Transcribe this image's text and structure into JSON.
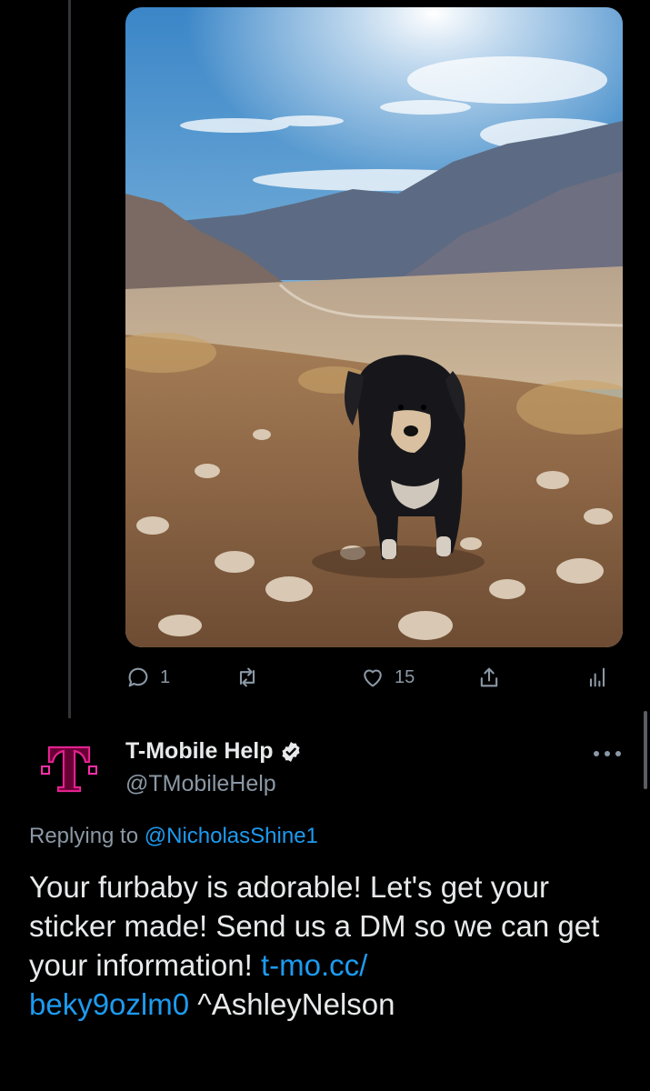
{
  "tweet": {
    "actions": {
      "reply_count": "1",
      "retweet_count": "",
      "like_count": "15"
    }
  },
  "reply": {
    "display_name": "T-Mobile Help",
    "handle": "@TMobileHelp",
    "replying_prefix": "Replying to ",
    "replying_to": "@NicholasShine1",
    "text_part1": "Your furbaby is adorable! Let's get your sticker made! Send us a DM so we can get your information! ",
    "link_line1": "t-mo.cc/",
    "link_line2": "beky9ozlm0",
    "text_part2": " ^AshleyNelson",
    "brand_color": "#e20074",
    "link_color": "#1d9bf0"
  }
}
